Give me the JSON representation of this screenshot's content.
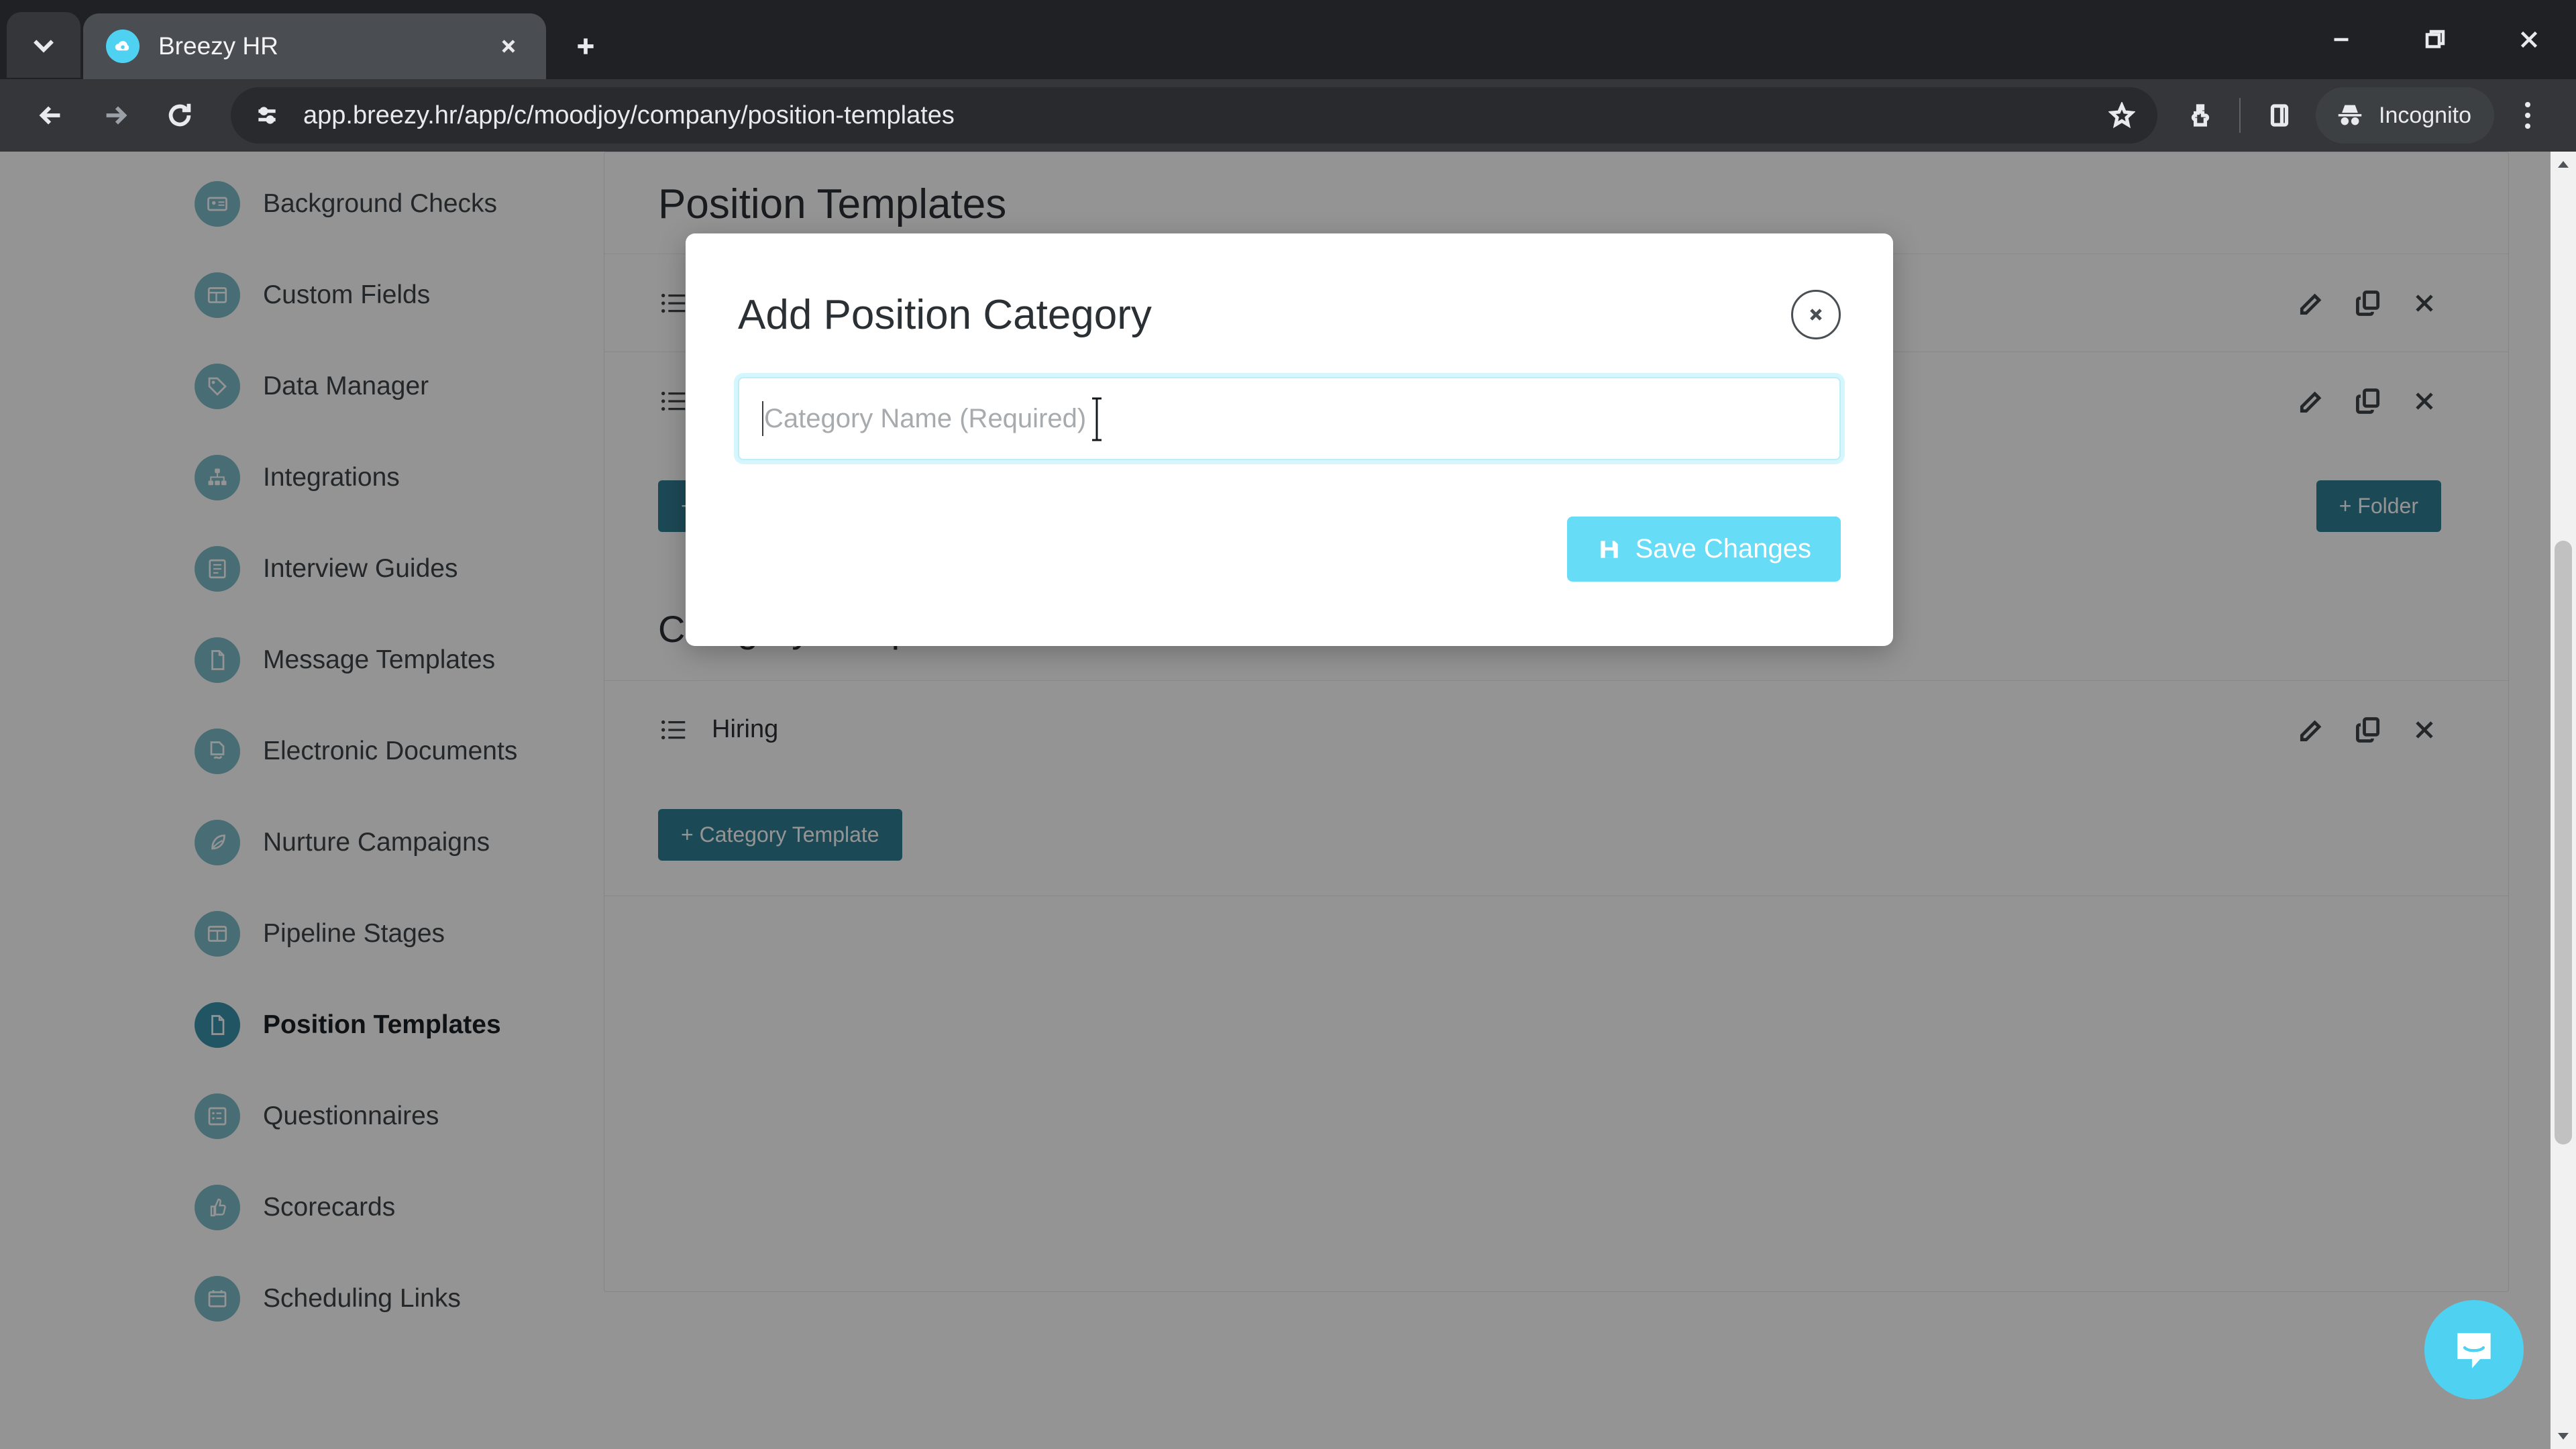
{
  "browser": {
    "tab": {
      "title": "Breezy HR",
      "favicon": "breezy-cloud-icon"
    },
    "tab_search_icon": "chevron-down-icon",
    "new_tab_icon": "plus-icon",
    "tab_close_icon": "close-icon",
    "nav": {
      "back_icon": "arrow-left-icon",
      "forward_icon": "arrow-right-icon",
      "reload_icon": "reload-icon"
    },
    "omnibox": {
      "site_info_icon": "tune-settings-icon",
      "url": "app.breezy.hr/app/c/moodjoy/company/position-templates",
      "bookmark_icon": "star-icon"
    },
    "toolbar_icons": {
      "extensions": "puzzle-piece-icon",
      "side_panel": "side-panel-icon",
      "menu": "three-dots-menu-icon"
    },
    "incognito": {
      "label": "Incognito",
      "icon": "incognito-hat-icon"
    },
    "window_controls": {
      "minimize": "minimize-icon",
      "maximize": "restore-icon",
      "close": "window-close-icon"
    }
  },
  "sidebar": {
    "items": [
      {
        "label": "Background Checks",
        "icon": "id-card-icon",
        "active": false
      },
      {
        "label": "Custom Fields",
        "icon": "table-icon",
        "active": false
      },
      {
        "label": "Data Manager",
        "icon": "tag-icon",
        "active": false
      },
      {
        "label": "Integrations",
        "icon": "network-icon",
        "active": false
      },
      {
        "label": "Interview Guides",
        "icon": "guide-book-icon",
        "active": false
      },
      {
        "label": "Message Templates",
        "icon": "document-icon",
        "active": false
      },
      {
        "label": "Electronic Documents",
        "icon": "document-sign-icon",
        "active": false
      },
      {
        "label": "Nurture Campaigns",
        "icon": "leaf-icon",
        "active": false
      },
      {
        "label": "Pipeline Stages",
        "icon": "columns-icon",
        "active": false
      },
      {
        "label": "Position Templates",
        "icon": "document-icon",
        "active": true
      },
      {
        "label": "Questionnaires",
        "icon": "list-check-icon",
        "active": false
      },
      {
        "label": "Scorecards",
        "icon": "thumbs-up-icon",
        "active": false
      },
      {
        "label": "Scheduling Links",
        "icon": "calendar-icon",
        "active": false
      }
    ]
  },
  "main": {
    "page_title": "Position Templates",
    "description_rows": [
      {
        "name": "",
        "list_icon": "list-icon",
        "edit_icon": "edit-icon",
        "copy_icon": "copy-icon",
        "delete_icon": "close-icon"
      },
      {
        "name": "",
        "list_icon": "list-icon",
        "edit_icon": "edit-icon",
        "copy_icon": "copy-icon",
        "delete_icon": "close-icon"
      }
    ],
    "add_description_template_label": "+ Description Template",
    "add_folder_label": "+ Folder",
    "category_section_title": "Category Templates",
    "category_rows": [
      {
        "name": "Hiring",
        "list_icon": "list-icon",
        "edit_icon": "edit-icon",
        "copy_icon": "copy-icon",
        "delete_icon": "close-icon"
      }
    ],
    "add_category_template_label": "+ Category Template"
  },
  "modal": {
    "title": "Add Position Category",
    "close_icon": "close-circle-icon",
    "input_placeholder": "Category Name (Required)",
    "input_value": "",
    "save_label": "Save Changes",
    "save_icon": "floppy-disk-icon"
  },
  "widgets": {
    "intercom_icon": "chat-bubble-icon"
  },
  "colors": {
    "brand_cyan": "#67dcf7",
    "teal_button": "#317f95",
    "nav_icon": "#7fbcc9",
    "nav_icon_active": "#3c93ab"
  }
}
